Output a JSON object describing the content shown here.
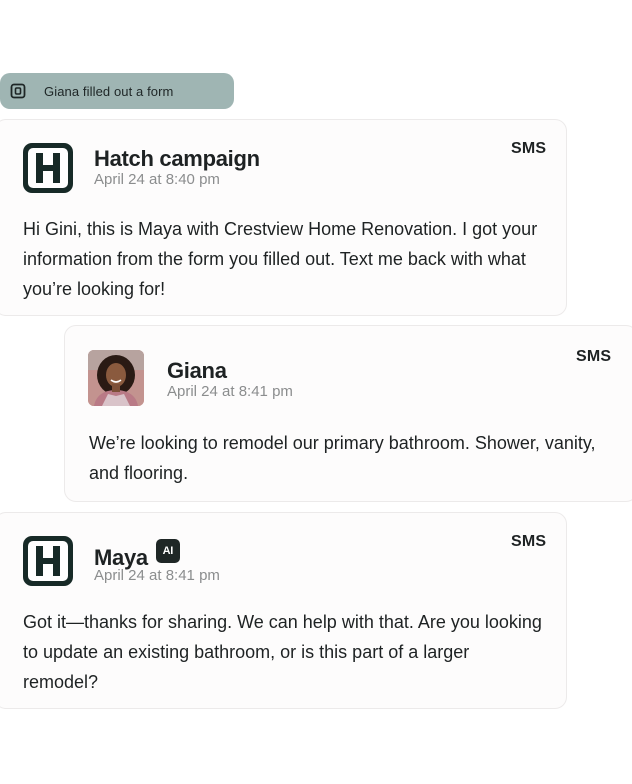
{
  "event_pill": {
    "icon": "form-icon",
    "text": "Giana filled out a form"
  },
  "messages": [
    {
      "sender": "Hatch campaign",
      "time": "April 24 at 8:40 pm",
      "channel": "SMS",
      "icon": "hatch-logo-icon",
      "text": "Hi Gini, this is Maya with Crestview Home Renovation. I got your information from the form you filled out. Text me back with what you’re looking for!"
    },
    {
      "sender": "Giana",
      "time": "April 24 at 8:41 pm",
      "channel": "SMS",
      "icon": "user-avatar",
      "text": "We’re looking to remodel our primary bathroom. Shower, vanity, and flooring."
    },
    {
      "sender": "Maya",
      "badge": "AI",
      "time": "April 24 at 8:41 pm",
      "channel": "SMS",
      "icon": "hatch-logo-icon",
      "text": "Got it—thanks for sharing. We can help with that. Are you looking to update an existing bathroom, or is this part of a larger remodel?"
    }
  ]
}
